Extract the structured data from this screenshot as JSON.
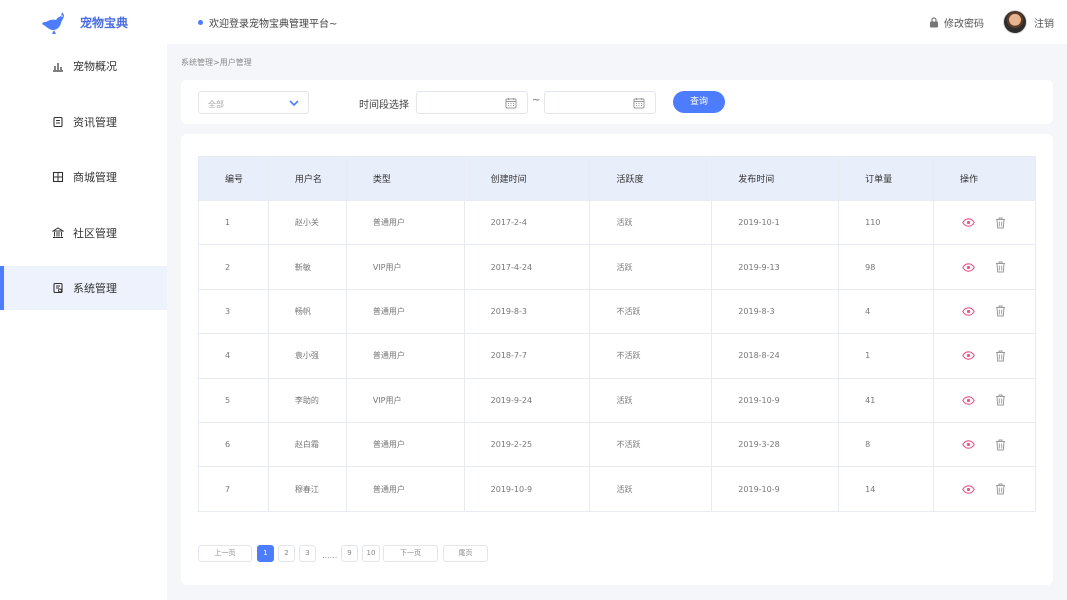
{
  "app": {
    "title": "宠物宝典",
    "brand_color": "#4d7cfe",
    "logo_icon": "kangaroo-logo-icon"
  },
  "sidebar": {
    "items": [
      {
        "label": "宠物概况",
        "icon": "bar-chart-icon",
        "active": false
      },
      {
        "label": "资讯管理",
        "icon": "document-icon",
        "active": false
      },
      {
        "label": "商城管理",
        "icon": "grid-icon",
        "active": false
      },
      {
        "label": "社区管理",
        "icon": "bank-icon",
        "active": false
      },
      {
        "label": "系统管理",
        "icon": "settings-doc-icon",
        "active": true
      }
    ]
  },
  "header": {
    "welcome": "欢迎登录宠物宝典管理平台~",
    "change_password": "修改密码",
    "logout": "注销"
  },
  "breadcrumb": "系统管理>用户管理",
  "filter": {
    "select_value": "全部",
    "range_label": "时间段选择",
    "separator": "~",
    "start_date": "",
    "end_date": "",
    "query_label": "查询"
  },
  "table": {
    "headers": [
      "编号",
      "用户名",
      "类型",
      "创建时间",
      "活跃度",
      "发布时间",
      "订单量",
      "操作"
    ],
    "rows": [
      {
        "id": "1",
        "username": "赵小关",
        "type": "普通用户",
        "created": "2017-2-4",
        "activity": "活跃",
        "published": "2019-10-1",
        "orders": "110"
      },
      {
        "id": "2",
        "username": "靳敏",
        "type": "VIP用户",
        "created": "2017-4-24",
        "activity": "活跃",
        "published": "2019-9-13",
        "orders": "98"
      },
      {
        "id": "3",
        "username": "畅帆",
        "type": "普通用户",
        "created": "2019-8-3",
        "activity": "不活跃",
        "published": "2019-8-3",
        "orders": "4"
      },
      {
        "id": "4",
        "username": "袁小强",
        "type": "普通用户",
        "created": "2018-7-7",
        "activity": "不活跃",
        "published": "2018-8-24",
        "orders": "1"
      },
      {
        "id": "5",
        "username": "李助的",
        "type": "VIP用户",
        "created": "2019-9-24",
        "activity": "活跃",
        "published": "2019-10-9",
        "orders": "41"
      },
      {
        "id": "6",
        "username": "赵白霜",
        "type": "普通用户",
        "created": "2019-2-25",
        "activity": "不活跃",
        "published": "2019-3-28",
        "orders": "8"
      },
      {
        "id": "7",
        "username": "穆春江",
        "type": "普通用户",
        "created": "2019-10-9",
        "activity": "活跃",
        "published": "2019-10-9",
        "orders": "14"
      }
    ],
    "view_icon_color": "#e8578a",
    "delete_icon_color": "#999999"
  },
  "pagination": {
    "prev": "上一页",
    "pages": [
      "1",
      "2",
      "3",
      "9",
      "10"
    ],
    "current": "1",
    "ellipsis": "......",
    "next": "下一页",
    "last": "尾页"
  }
}
